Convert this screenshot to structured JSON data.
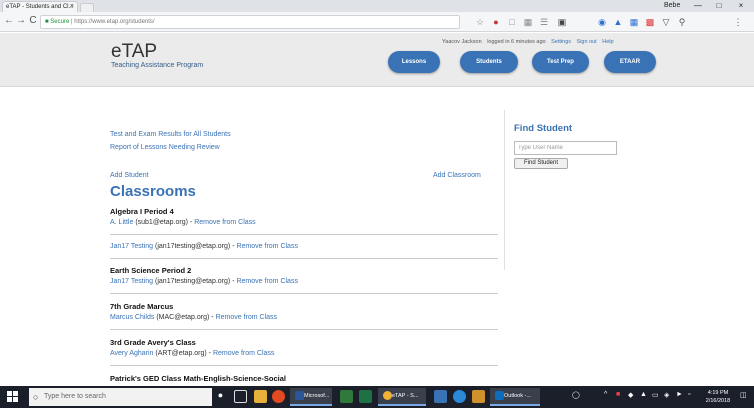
{
  "browser": {
    "tab_title": "eTAP - Students and Cl...",
    "tab_close": "×",
    "window_user": "Bebe",
    "window_controls": [
      "—",
      "□",
      "×"
    ],
    "nav": {
      "back": "←",
      "forward": "→",
      "reload": "C"
    },
    "address": {
      "secure_label": "Secure",
      "url": "https://www.etap.org/students/"
    },
    "extension_icons": [
      "star-icon",
      "extension-icon",
      "bookmark-icon",
      "grid-icon",
      "menu-icon",
      "cast-icon",
      "profile-icon",
      "translate-icon",
      "pdf-icon",
      "shield-icon",
      "location-icon",
      "settings-icon"
    ]
  },
  "header": {
    "logo": "eTAP",
    "tagline": "Teaching Assistance Program",
    "user_name": "Yaacov Jackson",
    "login_info": "logged in 6 minutes ago",
    "links": [
      "Settings",
      "Sign out",
      "Help"
    ],
    "nav_buttons": [
      "Lessons",
      "Students",
      "Test Prep",
      "ETAAR"
    ]
  },
  "main": {
    "links": [
      "Test and Exam Results for All Students",
      "Report of Lessons Needing Review"
    ],
    "add_student": "Add Student",
    "add_classroom": "Add Classroom",
    "classrooms_heading": "Classrooms",
    "classrooms": [
      {
        "title": "Algebra I Period 4",
        "students": [
          {
            "name": "A. Little",
            "email": "(sub1@etap.org)",
            "remove": "Remove from Class"
          },
          {
            "name": "Jan17 Testing",
            "email": "(jan17testing@etap.org)",
            "remove": "Remove from Class"
          }
        ]
      },
      {
        "title": "Earth Science Period 2",
        "students": [
          {
            "name": "Jan17 Testing",
            "email": "(jan17testing@etap.org)",
            "remove": "Remove from Class"
          }
        ]
      },
      {
        "title": "7th Grade Marcus",
        "students": [
          {
            "name": "Marcus Childs",
            "email": "(MAC@etap.org)",
            "remove": "Remove from Class"
          }
        ]
      },
      {
        "title": "3rd Grade Avery's Class",
        "students": [
          {
            "name": "Avery Agharin",
            "email": "(ART@etap.org)",
            "remove": "Remove from Class"
          }
        ]
      },
      {
        "title": "Patrick's GED Class Math-English-Science-Social",
        "students": []
      }
    ],
    "separator_dash": " - "
  },
  "sidebar": {
    "title": "Find Student",
    "input_placeholder": "Type User Name",
    "button": "Find Student"
  },
  "taskbar": {
    "search_placeholder": "Type here to search",
    "apps": [
      "Microsof...",
      "eTAP - S...",
      "Outlook -..."
    ],
    "time": "4:19 PM",
    "date": "2/16/2018",
    "colors": {
      "bar": "#1b1f2a",
      "accent": "#3a73b5"
    }
  }
}
